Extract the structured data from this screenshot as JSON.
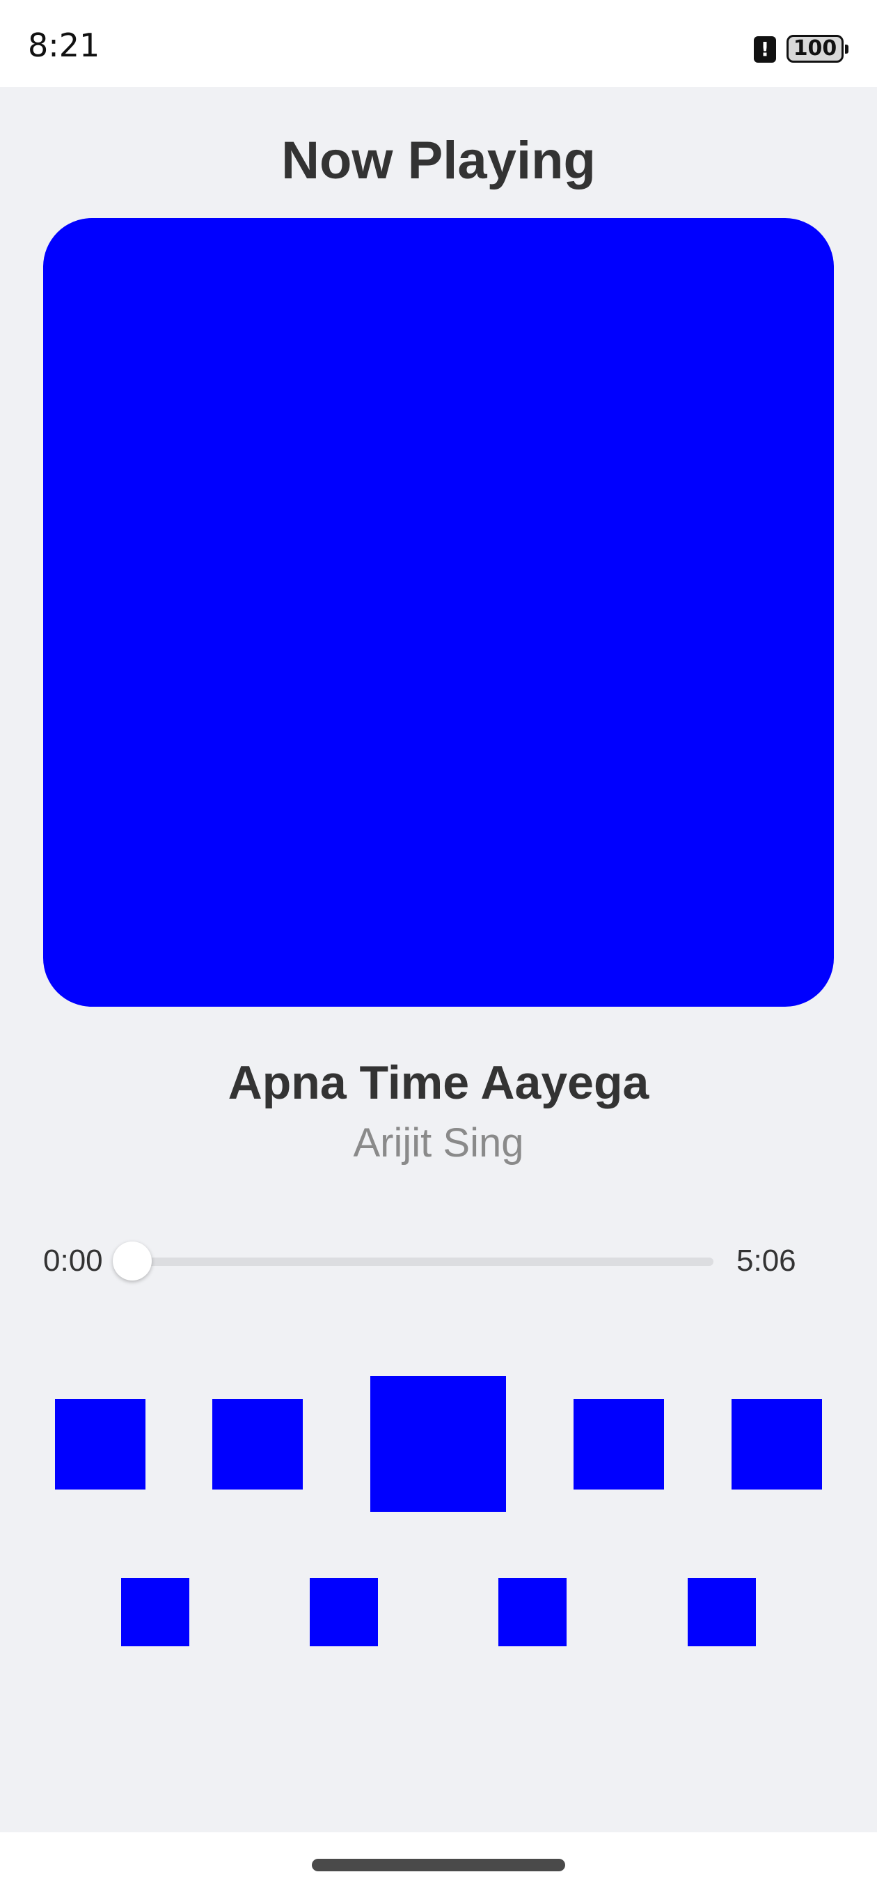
{
  "status_bar": {
    "time": "8:21",
    "alert_symbol": "!",
    "battery_level": "100"
  },
  "page": {
    "title": "Now Playing"
  },
  "track": {
    "title": "Apna Time Aayega",
    "artist": "Arijit Sing",
    "album_art_color": "#0000ff"
  },
  "player": {
    "current_time": "0:00",
    "total_time": "5:06",
    "progress": 0
  },
  "controls": {
    "primary_row_icons": [
      "control-icon-1",
      "control-icon-2",
      "play-icon",
      "control-icon-4",
      "control-icon-5"
    ],
    "secondary_row_icons": [
      "control-icon-6",
      "control-icon-7",
      "control-icon-8",
      "control-icon-9"
    ],
    "icon_color": "#0000ff"
  },
  "colors": {
    "background": "#f0f1f4",
    "text_primary": "#333333",
    "text_secondary": "#8a8a8a",
    "accent": "#0000ff"
  }
}
